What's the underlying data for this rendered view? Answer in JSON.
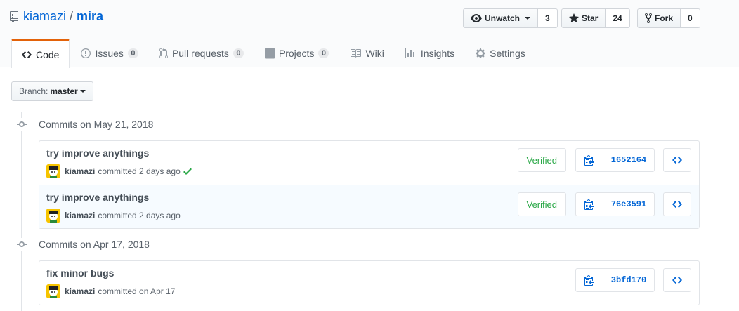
{
  "repo": {
    "owner": "kiamazi",
    "separator": "/",
    "name": "mira"
  },
  "actions": {
    "watch": {
      "label": "Unwatch",
      "count": "3"
    },
    "star": {
      "label": "Star",
      "count": "24"
    },
    "fork": {
      "label": "Fork",
      "count": "0"
    }
  },
  "tabs": [
    {
      "label": "Code",
      "count": null
    },
    {
      "label": "Issues",
      "count": "0"
    },
    {
      "label": "Pull requests",
      "count": "0"
    },
    {
      "label": "Projects",
      "count": "0"
    },
    {
      "label": "Wiki",
      "count": null
    },
    {
      "label": "Insights",
      "count": null
    },
    {
      "label": "Settings",
      "count": null
    }
  ],
  "branch": {
    "label": "Branch:",
    "value": "master"
  },
  "groups": [
    {
      "title": "Commits on May 21, 2018",
      "commits": [
        {
          "message": "try improve anythings",
          "author": "kiamazi",
          "when": "committed 2 days ago",
          "verified": "Verified",
          "sha": "1652164"
        },
        {
          "message": "try improve anythings",
          "author": "kiamazi",
          "when": "committed 2 days ago",
          "verified": "Verified",
          "sha": "76e3591"
        }
      ]
    },
    {
      "title": "Commits on Apr 17, 2018",
      "commits": [
        {
          "message": "fix minor bugs",
          "author": "kiamazi",
          "when": "committed on Apr 17",
          "sha": "3bfd170"
        }
      ]
    }
  ],
  "colors": {
    "link": "#0366d6",
    "verified": "#28a745",
    "tab_accent": "#e36209",
    "avatar": "#f6c400"
  }
}
